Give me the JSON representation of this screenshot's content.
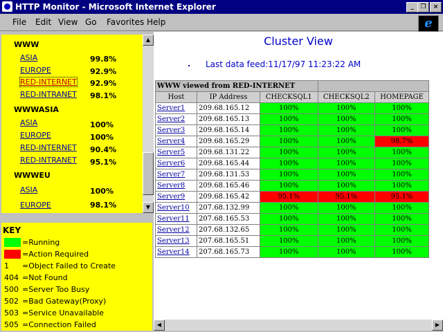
{
  "window": {
    "title": "HTTP Monitor - Microsoft Internet Explorer"
  },
  "menu": [
    "File",
    "Edit",
    "View",
    "Go",
    "Favorites",
    "Help"
  ],
  "groups": [
    {
      "title": "WWW",
      "items": [
        {
          "name": "ASIA",
          "pct": "99.8%"
        },
        {
          "name": "EUROPE",
          "pct": "92.9%"
        },
        {
          "name": "RED-INTERNET",
          "pct": "92.9%"
        },
        {
          "name": "RED-INTRANET",
          "pct": "98.1%"
        }
      ]
    },
    {
      "title": "WWWASIA",
      "items": [
        {
          "name": "ASIA",
          "pct": "100%"
        },
        {
          "name": "EUROPE",
          "pct": "100%"
        },
        {
          "name": "RED-INTERNET",
          "pct": "90.4%"
        },
        {
          "name": "RED-INTRANET",
          "pct": "95.1%"
        }
      ]
    },
    {
      "title": "WWWEU",
      "items": [
        {
          "name": "ASIA",
          "pct": "100%"
        },
        {
          "name": "EUROPE",
          "pct": "98.1%"
        }
      ]
    }
  ],
  "key": {
    "title": "KEY",
    "items": [
      {
        "code": "",
        "text": "=Running",
        "color": "#00ff00"
      },
      {
        "code": "",
        "text": "=Action Required",
        "color": "#ff0000"
      },
      {
        "code": "1",
        "text": "=Object Failed to Create"
      },
      {
        "code": "404",
        "text": "=Not Found"
      },
      {
        "code": "500",
        "text": "=Server Too Busy"
      },
      {
        "code": "502",
        "text": "=Bad Gateway(Proxy)"
      },
      {
        "code": "503",
        "text": "=Service Unavailable"
      },
      {
        "code": "505",
        "text": "=Connection Failed"
      }
    ]
  },
  "cluster": {
    "title": "Cluster View",
    "feed": "Last data feed:11/17/97 11:23:22 AM",
    "caption": "WWW viewed from RED-INTERNET",
    "columns": [
      "Host",
      "IP Address",
      "CHECKSQL1",
      "CHECKSQL2",
      "HOMEPAGE"
    ],
    "rows": [
      {
        "host": "Server1",
        "ip": "209.68.165.12",
        "c1": "100%",
        "c2": "100%",
        "hp": "100%",
        "s": [
          "ok",
          "ok",
          "ok"
        ]
      },
      {
        "host": "Server2",
        "ip": "209.68.165.13",
        "c1": "100%",
        "c2": "100%",
        "hp": "100%",
        "s": [
          "ok",
          "ok",
          "ok"
        ]
      },
      {
        "host": "Server3",
        "ip": "209.68.165.14",
        "c1": "100%",
        "c2": "100%",
        "hp": "100%",
        "s": [
          "ok",
          "ok",
          "ok"
        ]
      },
      {
        "host": "Server4",
        "ip": "209.68.165.29",
        "c1": "100%",
        "c2": "100%",
        "hp": "98.7%",
        "s": [
          "ok",
          "ok",
          "bad"
        ]
      },
      {
        "host": "Server5",
        "ip": "209.68.131.22",
        "c1": "100%",
        "c2": "100%",
        "hp": "100%",
        "s": [
          "ok",
          "ok",
          "ok"
        ]
      },
      {
        "host": "Server6",
        "ip": "209.68.165.44",
        "c1": "100%",
        "c2": "100%",
        "hp": "100%",
        "s": [
          "ok",
          "ok",
          "ok"
        ]
      },
      {
        "host": "Server7",
        "ip": "209.68.131.53",
        "c1": "100%",
        "c2": "100%",
        "hp": "100%",
        "s": [
          "ok",
          "ok",
          "ok"
        ]
      },
      {
        "host": "Server8",
        "ip": "209.68.165.46",
        "c1": "100%",
        "c2": "100%",
        "hp": "100%",
        "s": [
          "ok",
          "ok",
          "ok"
        ]
      },
      {
        "host": "Server9",
        "ip": "209.68.165.42",
        "c1": "95.1%",
        "c2": "95.1%",
        "hp": "95.1%",
        "s": [
          "bad",
          "bad",
          "bad"
        ]
      },
      {
        "host": "Server10",
        "ip": "207.68.132.99",
        "c1": "100%",
        "c2": "100%",
        "hp": "100%",
        "s": [
          "ok",
          "ok",
          "ok"
        ]
      },
      {
        "host": "Server11",
        "ip": "207.68.165.53",
        "c1": "100%",
        "c2": "100%",
        "hp": "100%",
        "s": [
          "ok",
          "ok",
          "ok"
        ]
      },
      {
        "host": "Server12",
        "ip": "207.68.132.65",
        "c1": "100%",
        "c2": "100%",
        "hp": "100%",
        "s": [
          "ok",
          "ok",
          "ok"
        ]
      },
      {
        "host": "Server13",
        "ip": "207.68.165.51",
        "c1": "100%",
        "c2": "100%",
        "hp": "100%",
        "s": [
          "ok",
          "ok",
          "ok"
        ]
      },
      {
        "host": "Server14",
        "ip": "207.68.165.73",
        "c1": "100%",
        "c2": "100%",
        "hp": "100%",
        "s": [
          "ok",
          "ok",
          "ok"
        ]
      }
    ]
  }
}
